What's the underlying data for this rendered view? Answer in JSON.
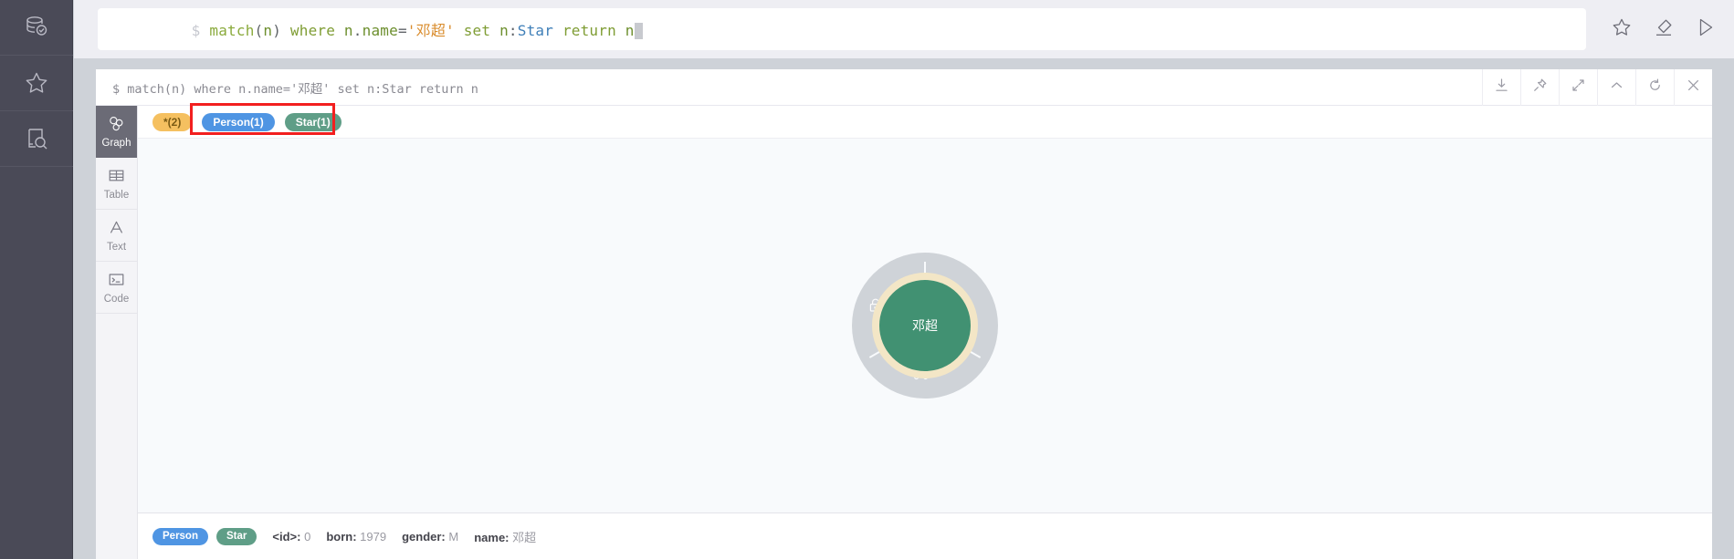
{
  "sidebar": {
    "items": [
      {
        "name": "database-check-icon",
        "label": ""
      },
      {
        "name": "star-icon",
        "label": ""
      },
      {
        "name": "document-search-icon",
        "label": ""
      }
    ]
  },
  "editor": {
    "prompt": "$",
    "query_tokens": [
      {
        "text": "match",
        "cls": "tk-fn"
      },
      {
        "text": "(",
        "cls": "tk-punct"
      },
      {
        "text": "n",
        "cls": "tk-ident"
      },
      {
        "text": ")",
        "cls": "tk-punct"
      },
      {
        "text": " ",
        "cls": "tk-plain"
      },
      {
        "text": "where",
        "cls": "tk-kw"
      },
      {
        "text": " ",
        "cls": "tk-plain"
      },
      {
        "text": "n",
        "cls": "tk-ident"
      },
      {
        "text": ".",
        "cls": "tk-punct"
      },
      {
        "text": "name",
        "cls": "tk-ident"
      },
      {
        "text": "=",
        "cls": "tk-op"
      },
      {
        "text": "'邓超'",
        "cls": "tk-str"
      },
      {
        "text": " ",
        "cls": "tk-plain"
      },
      {
        "text": "set",
        "cls": "tk-kw"
      },
      {
        "text": " ",
        "cls": "tk-plain"
      },
      {
        "text": "n",
        "cls": "tk-ident"
      },
      {
        "text": ":",
        "cls": "tk-punct"
      },
      {
        "text": "Star",
        "cls": "tk-label"
      },
      {
        "text": " ",
        "cls": "tk-plain"
      },
      {
        "text": "return",
        "cls": "tk-kw"
      },
      {
        "text": " ",
        "cls": "tk-plain"
      },
      {
        "text": "n",
        "cls": "tk-ident"
      }
    ],
    "query_plain": "match(n) where n.name='邓超' set n:Star return n",
    "actions": [
      {
        "name": "favorite-button",
        "icon": "star-icon"
      },
      {
        "name": "clear-button",
        "icon": "eraser-icon"
      },
      {
        "name": "run-button",
        "icon": "play-icon"
      }
    ]
  },
  "result": {
    "query_echo": "$ match(n) where n.name='邓超' set n:Star return n",
    "header_actions": [
      {
        "name": "download-button",
        "icon": "download-icon"
      },
      {
        "name": "pin-button",
        "icon": "pin-icon"
      },
      {
        "name": "fullscreen-button",
        "icon": "expand-icon"
      },
      {
        "name": "collapse-button",
        "icon": "chevron-up-icon"
      },
      {
        "name": "refresh-button",
        "icon": "refresh-icon"
      },
      {
        "name": "close-button",
        "icon": "close-icon"
      }
    ],
    "tabs": [
      {
        "label": "Graph",
        "icon": "graph-icon",
        "active": true
      },
      {
        "label": "Table",
        "icon": "table-icon",
        "active": false
      },
      {
        "label": "Text",
        "icon": "text-icon",
        "active": false
      },
      {
        "label": "Code",
        "icon": "code-icon",
        "active": false
      }
    ],
    "chips": [
      {
        "label": "*(2)",
        "cls": "star-all",
        "color": "#f5c060"
      },
      {
        "label": "Person(1)",
        "cls": "person",
        "color": "#4f95e3"
      },
      {
        "label": "Star(1)",
        "cls": "starlbl",
        "color": "#5f9e87"
      }
    ],
    "highlight_color": "#f21f1f",
    "graph": {
      "node_label": "邓超",
      "node_color": "#419172",
      "ring_color": "#f3e6c6",
      "halo_color": "#cfd3d8",
      "halo_actions": [
        {
          "name": "lock-icon"
        },
        {
          "name": "hide-node-icon"
        },
        {
          "name": "expand-node-icon"
        }
      ]
    },
    "properties": {
      "badges": [
        {
          "label": "Person",
          "cls": "person",
          "color": "#4f95e3"
        },
        {
          "label": "Star",
          "cls": "star",
          "color": "#5f9e87"
        }
      ],
      "fields": [
        {
          "key": "<id>:",
          "value": "0"
        },
        {
          "key": "born:",
          "value": "1979"
        },
        {
          "key": "gender:",
          "value": "M"
        },
        {
          "key": "name:",
          "value": "邓超"
        }
      ]
    }
  }
}
